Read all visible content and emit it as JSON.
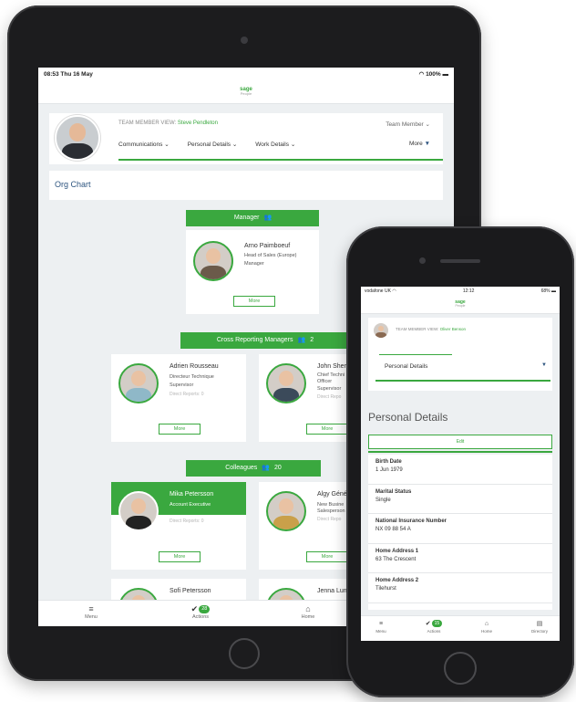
{
  "tablet": {
    "status": {
      "time": "08:53  Thu 16 May",
      "battery": "100%"
    },
    "brand": {
      "name": "sage",
      "product": "People"
    },
    "profile": {
      "view_label": "TEAM MEMBER VIEW:",
      "view_name": "Steve Pendleton",
      "role_select": "Team Member",
      "nav": [
        "Communications",
        "Personal Details",
        "Work Details"
      ],
      "nav_more": "More"
    },
    "section_title": "Org Chart",
    "manager": {
      "header": "Manager",
      "name": "Arno Paimboeuf",
      "title": "Head of Sales (Europe)",
      "sub": "Manager",
      "more": "More"
    },
    "cross": {
      "header": "Cross Reporting Managers",
      "count": "2",
      "people": [
        {
          "name": "Adrien Rousseau",
          "title": "Directeur Technique",
          "sub": "Supervisor",
          "dr": "Direct Reports: 0",
          "more": "More"
        },
        {
          "name": "John Sher",
          "title1": "Chief Techni",
          "title2": "Officer",
          "sub": "Supervisor",
          "dr": "Direct Repo",
          "more": "More"
        }
      ]
    },
    "colleagues": {
      "header": "Colleagues",
      "count": "20",
      "people": [
        {
          "name": "Mika Petersson",
          "title": "Account Executive",
          "dr": "Direct Reports: 0",
          "more": "More"
        },
        {
          "name": "Algy Géné",
          "title1": "New Busine",
          "title2": "Salesperson",
          "dr": "Direct Repo",
          "more": "More"
        },
        {
          "name": "Sofi Petersson"
        },
        {
          "name": "Jenna Lun"
        }
      ]
    },
    "bottom": {
      "menu": "Menu",
      "actions": "Actions",
      "actions_badge": "28",
      "home": "Home"
    }
  },
  "phone": {
    "status": {
      "carrier": "vodafone UK",
      "time": "12:12",
      "battery": "68%"
    },
    "brand": {
      "name": "sage",
      "product": "People"
    },
    "profile": {
      "view_label": "TEAM MEMBER VIEW:",
      "view_name": "Oliver Benson",
      "tab": "Personal Details"
    },
    "page_title": "Personal Details",
    "edit": "Edit",
    "fields": [
      {
        "label": "Birth Date",
        "value": "1 Jun 1979"
      },
      {
        "label": "Marital Status",
        "value": "Single"
      },
      {
        "label": "National Insurance Number",
        "value": "NX 09 88 54 A"
      },
      {
        "label": "Home Address 1",
        "value": "63 The Crescent"
      },
      {
        "label": "Home Address 2",
        "value": "Tilehurst"
      }
    ],
    "bottom": {
      "menu": "Menu",
      "actions": "Actions",
      "actions_badge": "15",
      "home": "Home",
      "directory": "Directory"
    }
  },
  "icons": {
    "people": "people-icon",
    "chevron": "chevron-down-icon",
    "menu": "hamburger-icon",
    "check": "check-icon",
    "home": "home-icon",
    "directory": "book-icon"
  },
  "colors": {
    "accent": "#3aa83f",
    "link": "#2f5680",
    "bezel": "#1c1c1e",
    "screen_bg": "#edf0f2"
  }
}
